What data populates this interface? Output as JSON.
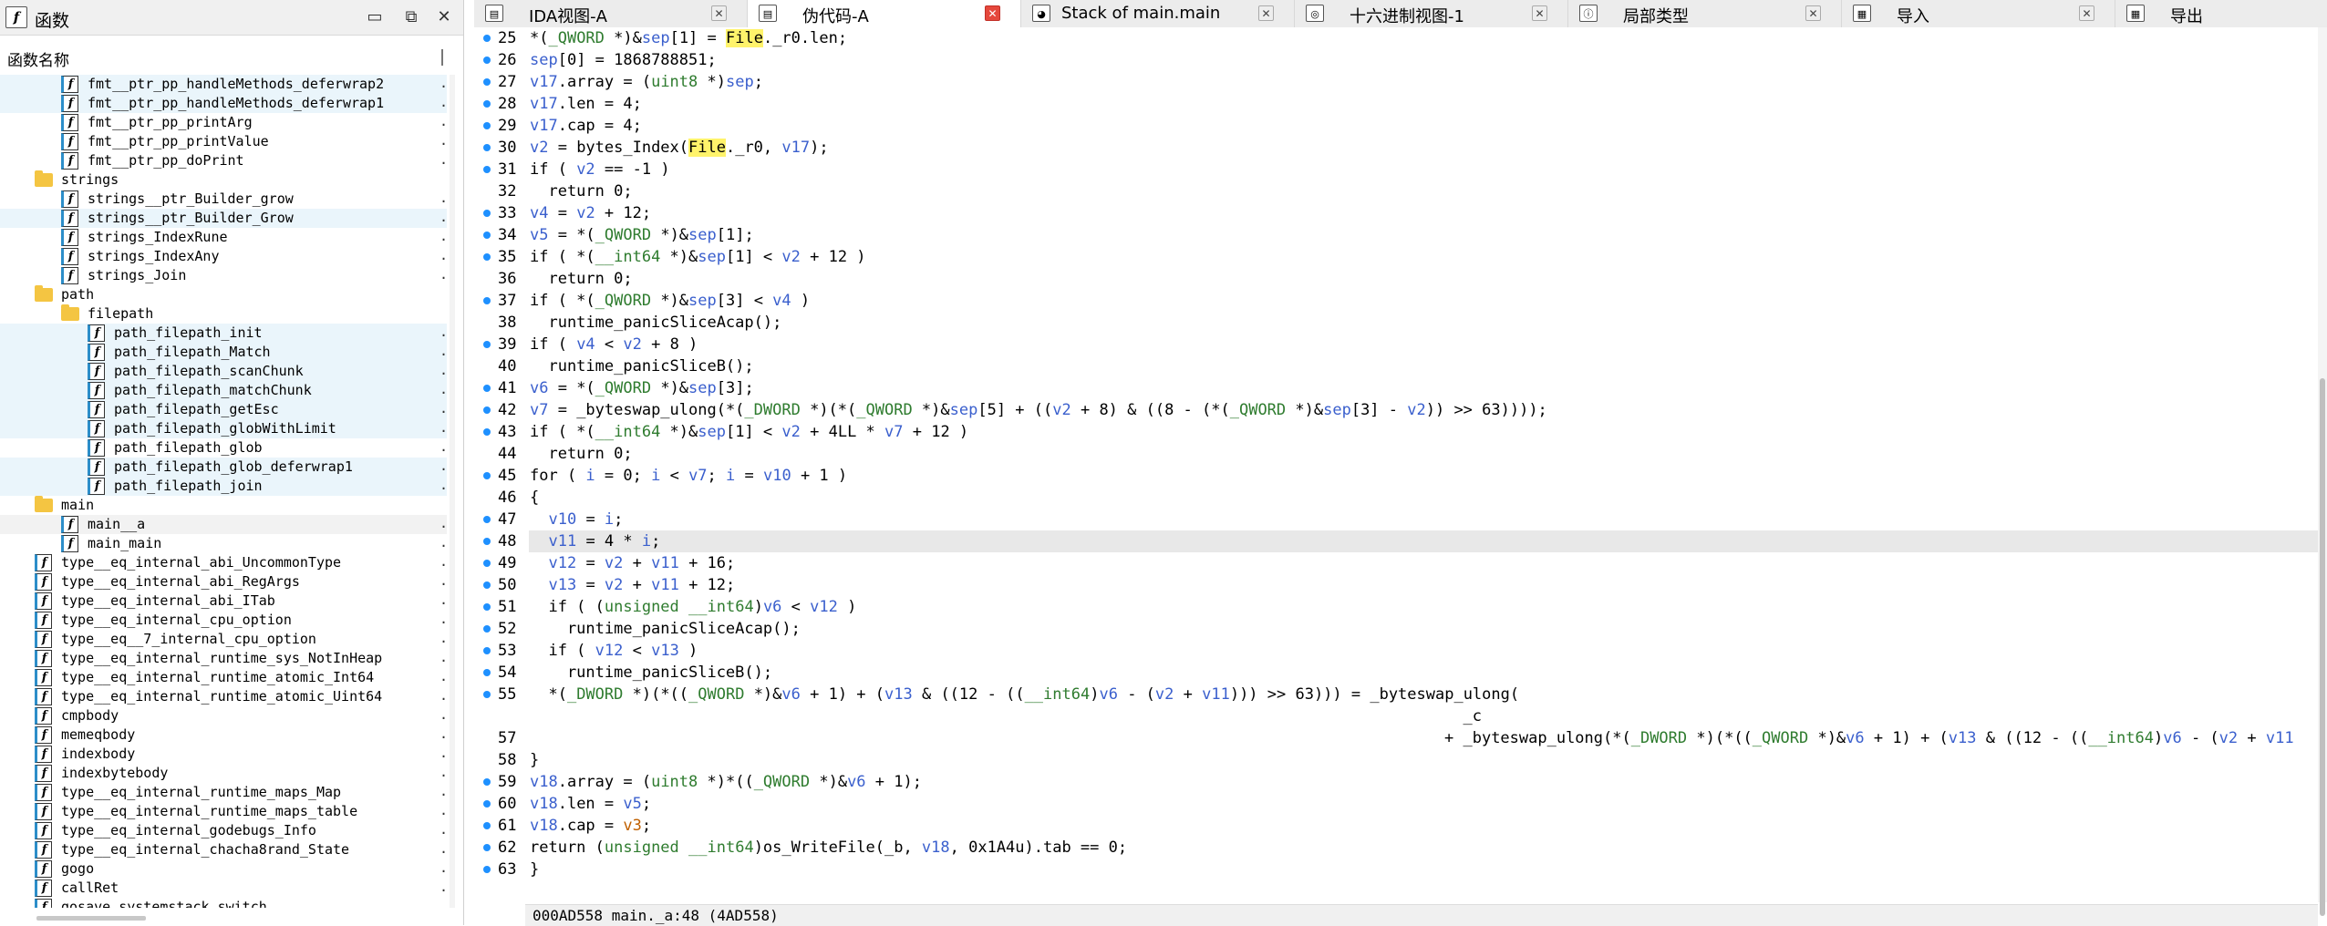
{
  "left_panel": {
    "title": "函数",
    "column_header": "函数名称",
    "buttons": {
      "restore": "▭",
      "maximize": "⧉",
      "close": "✕"
    },
    "items": [
      {
        "kind": "func",
        "indent": 1,
        "label": "fmt__ptr_pp_handleMethods_deferwrap2",
        "hl": true
      },
      {
        "kind": "func",
        "indent": 1,
        "label": "fmt__ptr_pp_handleMethods_deferwrap1",
        "hl": true
      },
      {
        "kind": "func",
        "indent": 1,
        "label": "fmt__ptr_pp_printArg"
      },
      {
        "kind": "func",
        "indent": 1,
        "label": "fmt__ptr_pp_printValue"
      },
      {
        "kind": "func",
        "indent": 1,
        "label": "fmt__ptr_pp_doPrint"
      },
      {
        "kind": "folder",
        "indent": 0,
        "label": "strings"
      },
      {
        "kind": "func",
        "indent": 1,
        "label": "strings__ptr_Builder_grow"
      },
      {
        "kind": "func",
        "indent": 1,
        "label": "strings__ptr_Builder_Grow",
        "hl": true
      },
      {
        "kind": "func",
        "indent": 1,
        "label": "strings_IndexRune"
      },
      {
        "kind": "func",
        "indent": 1,
        "label": "strings_IndexAny"
      },
      {
        "kind": "func",
        "indent": 1,
        "label": "strings_Join"
      },
      {
        "kind": "folder",
        "indent": 0,
        "label": "path"
      },
      {
        "kind": "folder",
        "indent": 1,
        "label": "filepath"
      },
      {
        "kind": "func",
        "indent": 2,
        "label": "path_filepath_init",
        "hl": true
      },
      {
        "kind": "func",
        "indent": 2,
        "label": "path_filepath_Match",
        "hl": true
      },
      {
        "kind": "func",
        "indent": 2,
        "label": "path_filepath_scanChunk",
        "hl": true
      },
      {
        "kind": "func",
        "indent": 2,
        "label": "path_filepath_matchChunk",
        "hl": true
      },
      {
        "kind": "func",
        "indent": 2,
        "label": "path_filepath_getEsc",
        "hl": true
      },
      {
        "kind": "func",
        "indent": 2,
        "label": "path_filepath_globWithLimit",
        "hl": true
      },
      {
        "kind": "func",
        "indent": 2,
        "label": "path_filepath_glob"
      },
      {
        "kind": "func",
        "indent": 2,
        "label": "path_filepath_glob_deferwrap1",
        "hl": true
      },
      {
        "kind": "func",
        "indent": 2,
        "label": "path_filepath_join",
        "hl": true
      },
      {
        "kind": "folder",
        "indent": 0,
        "label": "main"
      },
      {
        "kind": "func",
        "indent": 1,
        "label": "main__a",
        "sel": true
      },
      {
        "kind": "func",
        "indent": 1,
        "label": "main_main"
      },
      {
        "kind": "func",
        "indent": 0,
        "label": "type__eq_internal_abi_UncommonType"
      },
      {
        "kind": "func",
        "indent": 0,
        "label": "type__eq_internal_abi_RegArgs"
      },
      {
        "kind": "func",
        "indent": 0,
        "label": "type__eq_internal_abi_ITab"
      },
      {
        "kind": "func",
        "indent": 0,
        "label": "type__eq_internal_cpu_option"
      },
      {
        "kind": "func",
        "indent": 0,
        "label": "type__eq__7_internal_cpu_option"
      },
      {
        "kind": "func",
        "indent": 0,
        "label": "type__eq_internal_runtime_sys_NotInHeap"
      },
      {
        "kind": "func",
        "indent": 0,
        "label": "type__eq_internal_runtime_atomic_Int64"
      },
      {
        "kind": "func",
        "indent": 0,
        "label": "type__eq_internal_runtime_atomic_Uint64"
      },
      {
        "kind": "func",
        "indent": 0,
        "label": "cmpbody"
      },
      {
        "kind": "func",
        "indent": 0,
        "label": "memeqbody"
      },
      {
        "kind": "func",
        "indent": 0,
        "label": "indexbody"
      },
      {
        "kind": "func",
        "indent": 0,
        "label": "indexbytebody"
      },
      {
        "kind": "func",
        "indent": 0,
        "label": "type__eq_internal_runtime_maps_Map"
      },
      {
        "kind": "func",
        "indent": 0,
        "label": "type__eq_internal_runtime_maps_table"
      },
      {
        "kind": "func",
        "indent": 0,
        "label": "type__eq_internal_godebugs_Info"
      },
      {
        "kind": "func",
        "indent": 0,
        "label": "type__eq_internal_chacha8rand_State"
      },
      {
        "kind": "func",
        "indent": 0,
        "label": "gogo"
      },
      {
        "kind": "func",
        "indent": 0,
        "label": "callRet"
      },
      {
        "kind": "func",
        "indent": 0,
        "label": "gosave_systemstack_switch"
      }
    ]
  },
  "tabs": [
    {
      "label": "IDA视图-A",
      "icon": "▤",
      "close_color": "grey"
    },
    {
      "label": "伪代码-A",
      "icon": "▤",
      "close_color": "red",
      "active": true
    },
    {
      "label": "Stack of main.main",
      "icon": "◕",
      "close_color": "grey"
    },
    {
      "label": "十六进制视图-1",
      "icon": "◎",
      "close_color": "grey"
    },
    {
      "label": "局部类型",
      "icon": "ⓘ",
      "close_color": "grey"
    },
    {
      "label": "导入",
      "icon": "▦",
      "close_color": "grey"
    },
    {
      "label": "导出",
      "icon": "▦",
      "close_color": "grey"
    }
  ],
  "code": {
    "lines": [
      {
        "n": "25",
        "b": true,
        "t": "*(_QWORD *)&sep[1] = File._r0.len;"
      },
      {
        "n": "26",
        "b": true,
        "t": "sep[0] = 1868788851;"
      },
      {
        "n": "27",
        "b": true,
        "t": "v17.array = (uint8 *)sep;"
      },
      {
        "n": "28",
        "b": true,
        "t": "v17.len = 4;"
      },
      {
        "n": "29",
        "b": true,
        "t": "v17.cap = 4;"
      },
      {
        "n": "30",
        "b": true,
        "t": "v2 = bytes_Index(File._r0, v17);"
      },
      {
        "n": "31",
        "b": true,
        "t": "if ( v2 == -1 )"
      },
      {
        "n": "32",
        "b": false,
        "t": "  return 0;"
      },
      {
        "n": "33",
        "b": true,
        "t": "v4 = v2 + 12;"
      },
      {
        "n": "34",
        "b": true,
        "t": "v5 = *(_QWORD *)&sep[1];"
      },
      {
        "n": "35",
        "b": true,
        "t": "if ( *(__int64 *)&sep[1] < v2 + 12 )"
      },
      {
        "n": "36",
        "b": false,
        "t": "  return 0;"
      },
      {
        "n": "37",
        "b": true,
        "t": "if ( *(_QWORD *)&sep[3] < v4 )"
      },
      {
        "n": "38",
        "b": false,
        "t": "  runtime_panicSliceAcap();"
      },
      {
        "n": "39",
        "b": true,
        "t": "if ( v4 < v2 + 8 )"
      },
      {
        "n": "40",
        "b": false,
        "t": "  runtime_panicSliceB();"
      },
      {
        "n": "41",
        "b": true,
        "t": "v6 = *(_QWORD *)&sep[3];"
      },
      {
        "n": "42",
        "b": true,
        "t": "v7 = _byteswap_ulong(*(_DWORD *)(*(_QWORD *)&sep[5] + ((v2 + 8) & ((8 - (*(_QWORD *)&sep[3] - v2)) >> 63))));"
      },
      {
        "n": "43",
        "b": true,
        "t": "if ( *(__int64 *)&sep[1] < v2 + 4LL * v7 + 12 )"
      },
      {
        "n": "44",
        "b": false,
        "t": "  return 0;"
      },
      {
        "n": "45",
        "b": true,
        "t": "for ( i = 0; i < v7; i = v10 + 1 )"
      },
      {
        "n": "46",
        "b": false,
        "t": "{"
      },
      {
        "n": "47",
        "b": true,
        "t": "  v10 = i;"
      },
      {
        "n": "48",
        "b": true,
        "t": "  v11 = 4 * i;"
      },
      {
        "n": "49",
        "b": true,
        "t": "  v12 = v2 + v11 + 16;"
      },
      {
        "n": "50",
        "b": true,
        "t": "  v13 = v2 + v11 + 12;"
      },
      {
        "n": "51",
        "b": true,
        "t": "  if ( (unsigned __int64)v6 < v12 )"
      },
      {
        "n": "52",
        "b": true,
        "t": "    runtime_panicSliceAcap();"
      },
      {
        "n": "53",
        "b": true,
        "t": "  if ( v12 < v13 )"
      },
      {
        "n": "54",
        "b": true,
        "t": "    runtime_panicSliceB();"
      },
      {
        "n": "55",
        "b": true,
        "t": "  *(_DWORD *)(*((_QWORD *)&v6 + 1) + (v13 & ((12 - ((__int64)v6 - (v2 + v11))) >> 63))) = _byteswap_ulong("
      },
      {
        "n": "",
        "b": false,
        "t": "                                                                                                    _c"
      },
      {
        "n": "57",
        "b": false,
        "t": "                                                                                                  + _byteswap_ulong(*(_DWORD *)(*((_QWORD *)&v6 + 1) + (v13 & ((12 - ((__int64)v6 - (v2 + v11"
      },
      {
        "n": "58",
        "b": false,
        "t": "}"
      },
      {
        "n": "59",
        "b": true,
        "t": "v18.array = (uint8 *)*((_QWORD *)&v6 + 1);"
      },
      {
        "n": "60",
        "b": true,
        "t": "v18.len = v5;"
      },
      {
        "n": "61",
        "b": true,
        "t": "v18.cap = v3;"
      },
      {
        "n": "62",
        "b": true,
        "t": "return (unsigned __int64)os_WriteFile(_b, v18, 0x1A4u).tab == 0;"
      },
      {
        "n": "63",
        "b": true,
        "t": "}"
      }
    ],
    "current_line_index": 23
  },
  "status_bar": {
    "text": "000AD558 main._a:48 (4AD558)"
  }
}
